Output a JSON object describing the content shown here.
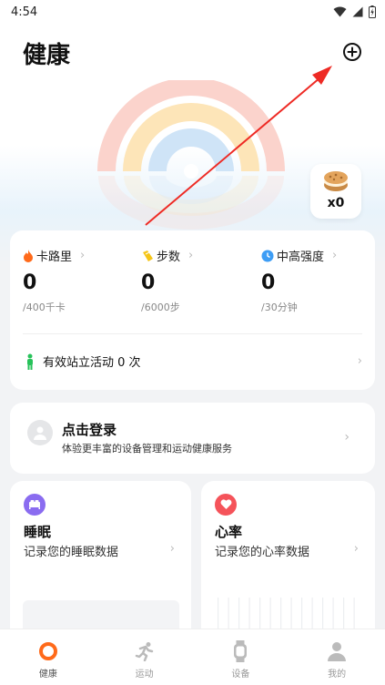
{
  "status_bar": {
    "time": "4:54"
  },
  "header": {
    "title": "健康",
    "add_icon": "plus-circle-icon"
  },
  "reward": {
    "icon": "cookie-icon",
    "count": "x0"
  },
  "stats": [
    {
      "label": "卡路里",
      "icon": "flame-icon",
      "color": "#ff6a1a",
      "value": "0",
      "goal": "/400千卡"
    },
    {
      "label": "步数",
      "icon": "shoe-icon",
      "color": "#f5c518",
      "value": "0",
      "goal": "/6000步"
    },
    {
      "label": "中高强度",
      "icon": "clock-icon",
      "color": "#3d9df5",
      "value": "0",
      "goal": "/30分钟"
    }
  ],
  "stand": {
    "icon": "standing-person-icon",
    "color": "#27c25a",
    "text": "有效站立活动  0 次"
  },
  "login": {
    "title": "点击登录",
    "subtitle": "体验更丰富的设备管理和运动健康服务"
  },
  "features": {
    "sleep": {
      "title": "睡眠",
      "subtitle": "记录您的睡眠数据",
      "icon": "bed-icon",
      "color": "#8a6cf0"
    },
    "heart": {
      "title": "心率",
      "subtitle": "记录您的心率数据",
      "icon": "heart-icon",
      "color": "#f5535a"
    }
  },
  "tabs": [
    {
      "label": "健康",
      "icon": "ring-icon",
      "active": true
    },
    {
      "label": "运动",
      "icon": "runner-icon",
      "active": false
    },
    {
      "label": "设备",
      "icon": "watch-icon",
      "active": false
    },
    {
      "label": "我的",
      "icon": "person-icon",
      "active": false
    }
  ],
  "colors": {
    "accent": "#ff6a1a",
    "ring_outer": "#fbd3cc",
    "ring_mid": "#fde5b8",
    "ring_inner": "#cfe4f7"
  }
}
